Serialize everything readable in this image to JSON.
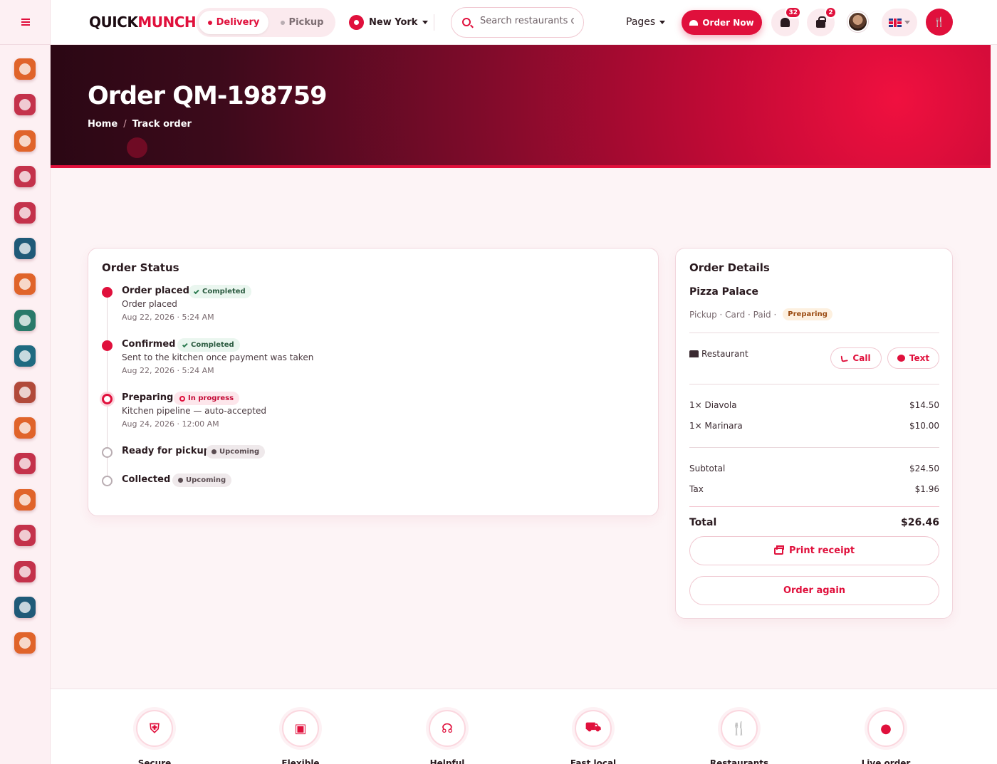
{
  "topbar": {
    "logo_dark": "QUICK",
    "logo_red": "MUNCH.",
    "mode_delivery": "Delivery",
    "mode_pickup": "Pickup",
    "city": "New York",
    "search_placeholder": "Search restaurants or dishes",
    "pages_label": "Pages",
    "order_now": "Order Now",
    "notifications_count": "32",
    "cart_count": "2",
    "language": "English (UK)"
  },
  "colors": {
    "accent": "#e0103c",
    "hero_dark": "#2b0714"
  },
  "sidebar": {
    "categories": [
      {
        "name": "bakery-icon",
        "color": "#e0642a"
      },
      {
        "name": "coffee-icon",
        "color": "#c4324b"
      },
      {
        "name": "soup-icon",
        "color": "#e0642a"
      },
      {
        "name": "cake-icon",
        "color": "#c4324b"
      },
      {
        "name": "plate-icon",
        "color": "#c4324b"
      },
      {
        "name": "wine-icon",
        "color": "#1f5a78"
      },
      {
        "name": "cutlery-icon",
        "color": "#e0642a"
      },
      {
        "name": "pizza-icon",
        "color": "#2a7a6a"
      },
      {
        "name": "sandwich-icon",
        "color": "#1f6a80"
      },
      {
        "name": "burger-icon",
        "color": "#b14a3a"
      },
      {
        "name": "meat-icon",
        "color": "#e0642a"
      },
      {
        "name": "shrimp-icon",
        "color": "#c4324b"
      },
      {
        "name": "chicken-icon",
        "color": "#e0642a"
      },
      {
        "name": "noodles-icon",
        "color": "#c4324b"
      },
      {
        "name": "taco-icon",
        "color": "#c4324b"
      },
      {
        "name": "drink-icon",
        "color": "#1f5a78"
      },
      {
        "name": "cookie-icon",
        "color": "#e0642a"
      }
    ]
  },
  "hero": {
    "title": "Order QM-198759",
    "breadcrumb_home": "Home",
    "breadcrumb_sep": "/",
    "breadcrumb_current": "Track order"
  },
  "status": {
    "title": "Order Status",
    "steps": [
      {
        "title": "Order placed",
        "state": "Completed",
        "desc": "Order placed",
        "time": "Aug 22, 2026 · 5:24 AM"
      },
      {
        "title": "Confirmed",
        "state": "Completed",
        "desc": "Sent to the kitchen once payment was taken",
        "time": "Aug 22, 2026 · 5:24 AM"
      },
      {
        "title": "Preparing",
        "state": "In progress",
        "desc": "Kitchen pipeline — auto-accepted",
        "time": "Aug 24, 2026 · 12:00 AM"
      },
      {
        "title": "Ready for pickup",
        "state": "Upcoming"
      },
      {
        "title": "Collected",
        "state": "Upcoming"
      }
    ]
  },
  "details": {
    "title": "Order Details",
    "restaurant_name": "Pizza Palace",
    "meta": "Pickup · Card · Paid ·",
    "status_badge": "Preparing",
    "restaurant_label": "Restaurant",
    "call_label": "Call",
    "text_label": "Text",
    "items": [
      {
        "name": "1× Diavola",
        "price": "$14.50"
      },
      {
        "name": "1× Marinara",
        "price": "$10.00"
      }
    ],
    "subtotal_label": "Subtotal",
    "subtotal": "$24.50",
    "tax_label": "Tax",
    "tax": "$1.96",
    "total_label": "Total",
    "total": "$26.46",
    "print_label": "Print receipt",
    "reorder_label": "Order again"
  },
  "features": [
    {
      "icon": "shield-icon",
      "label": "Secure"
    },
    {
      "icon": "wallet-icon",
      "label": "Flexible"
    },
    {
      "icon": "headset-icon",
      "label": "Helpful"
    },
    {
      "icon": "truck-icon",
      "label": "Fast local"
    },
    {
      "icon": "cutlery-icon",
      "label": "Restaurants"
    },
    {
      "icon": "location-pin-icon",
      "label": "Live order"
    }
  ]
}
